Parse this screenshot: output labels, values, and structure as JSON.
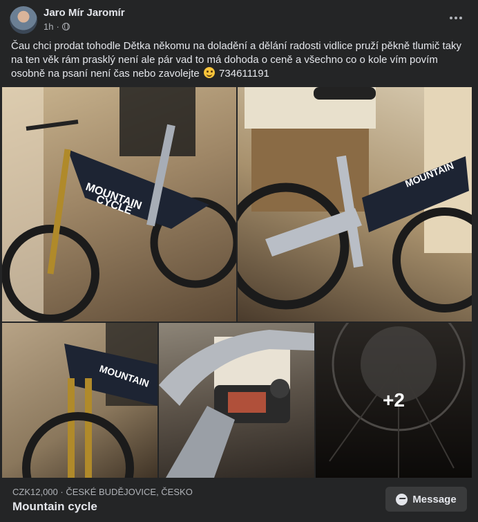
{
  "post": {
    "author": "Jaro Mír Jaromír",
    "time": "1h",
    "audience_icon": "globe-icon",
    "text_before_emoji": "Čau chci prodat tohodle Dětka někomu na doladění a dělání radosti vidlice pruží pěkně tlumič taky na ten věk rám prasklý není ale pár vad to má dohoda o ceně a všechno co o kole vím povím osobně na psaní není čas nebo zavolejte",
    "emoji": "winking-face-emoji",
    "phone": "734611191"
  },
  "photos": {
    "more_count": "+2"
  },
  "listing": {
    "price_location": "CZK12,000 · ČESKÉ BUDĚJOVICE, ČESKO",
    "title": "Mountain cycle",
    "message_button": "Message"
  },
  "colors": {
    "background": "#242526",
    "button": "#3a3b3c",
    "text_primary": "#e4e6eb",
    "text_secondary": "#b0b3b8"
  }
}
